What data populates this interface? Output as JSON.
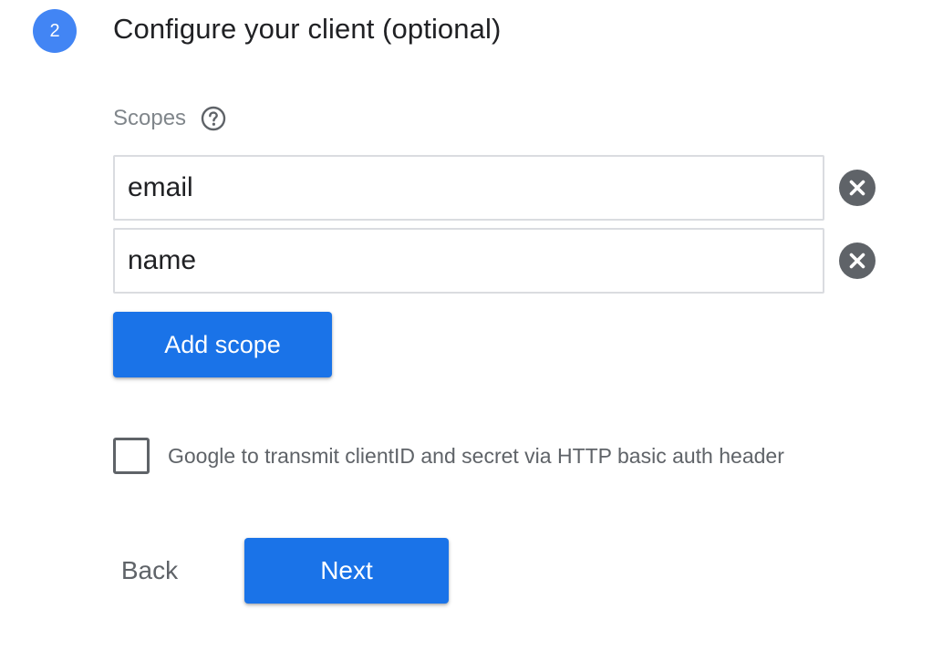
{
  "step": {
    "number": "2",
    "title": "Configure your client (optional)"
  },
  "scopes": {
    "label": "Scopes",
    "help_icon": "help-circle-icon",
    "items": [
      {
        "value": "email",
        "remove_icon": "close-circle-icon"
      },
      {
        "value": "name",
        "remove_icon": "close-circle-icon"
      }
    ],
    "add_label": "Add scope"
  },
  "basic_auth": {
    "checked": false,
    "label": "Google to transmit clientID and secret via HTTP basic auth header"
  },
  "actions": {
    "back_label": "Back",
    "next_label": "Next"
  },
  "colors": {
    "primary": "#1a73e8",
    "step_badge": "#4285f4",
    "icon_gray": "#5f6368",
    "border": "#dadce0"
  }
}
